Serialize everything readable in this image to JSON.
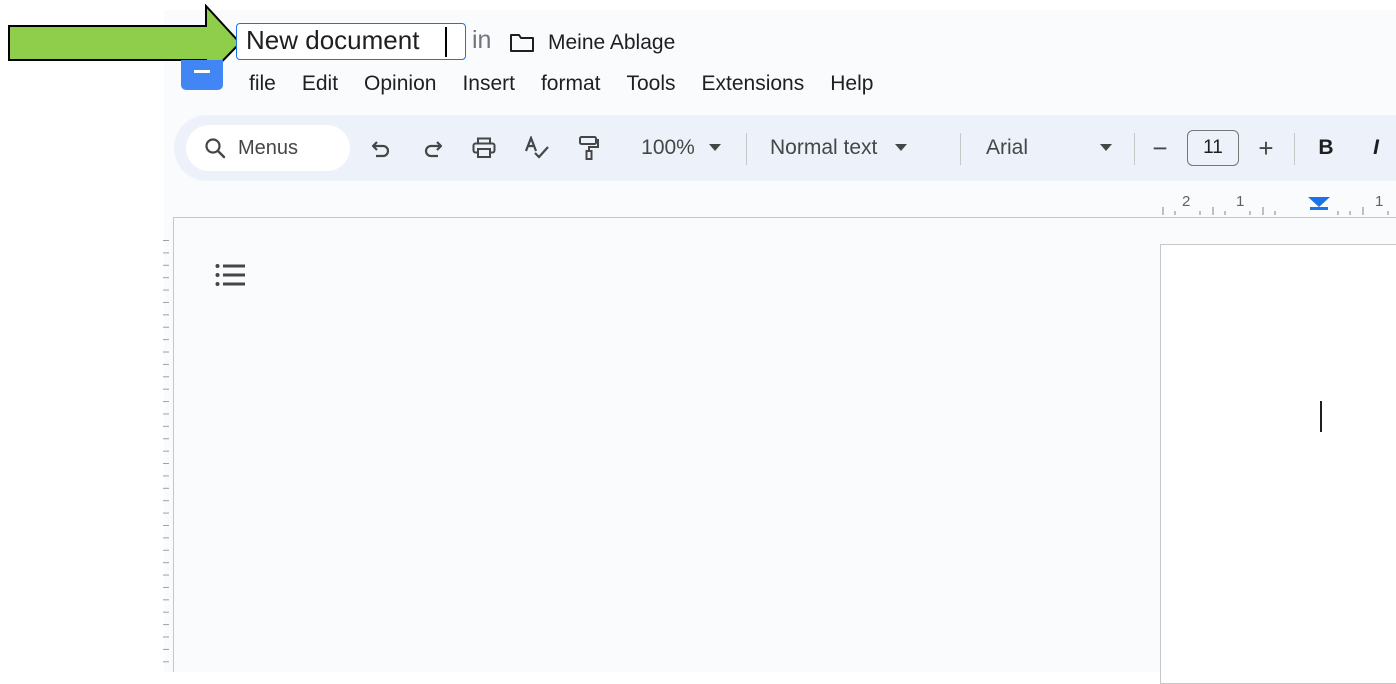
{
  "document": {
    "title_value": "New document",
    "in_label": "in",
    "folder_name": "Meine Ablage"
  },
  "menubar": {
    "items": [
      "file",
      "Edit",
      "Opinion",
      "Insert",
      "format",
      "Tools",
      "Extensions",
      "Help"
    ]
  },
  "toolbar": {
    "search_label": "Menus",
    "zoom_value": "100%",
    "style_value": "Normal text",
    "font_value": "Arial",
    "font_size_value": "11",
    "bold_label": "B",
    "italic_label": "I",
    "decrease_label": "−",
    "increase_label": "+"
  },
  "ruler": {
    "labels": [
      "2",
      "1",
      "1"
    ]
  },
  "colors": {
    "accent": "#1a73e8",
    "docs_brand": "#4285f4",
    "annotation_arrow": "#8fce4a",
    "toolbar_bg": "#edf2fa",
    "app_bg": "#f9fbfd"
  },
  "icons": {
    "search": "search-icon",
    "undo": "undo-icon",
    "redo": "redo-icon",
    "print": "print-icon",
    "spellcheck": "spellcheck-icon",
    "paint_format": "paint-format-icon",
    "outline": "document-outline-icon",
    "folder": "folder-icon"
  }
}
